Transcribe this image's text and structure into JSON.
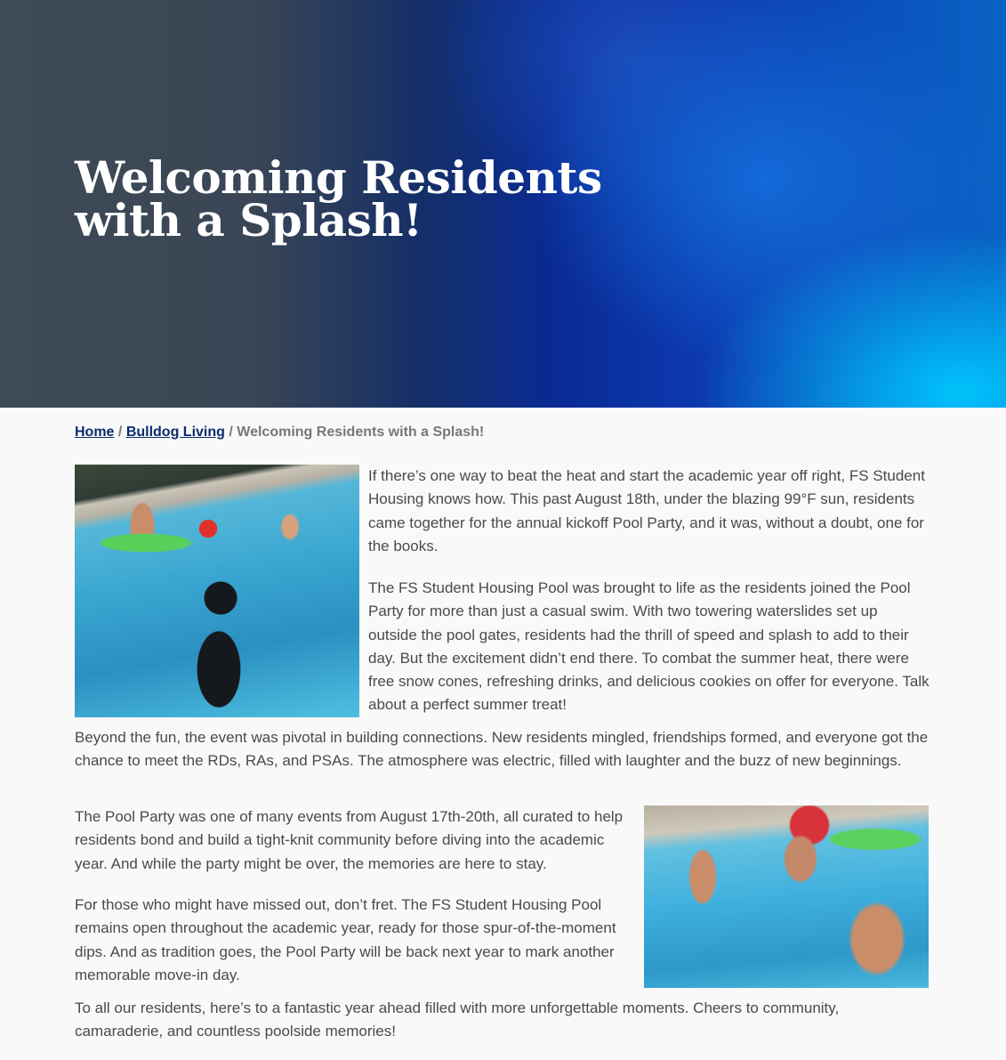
{
  "hero": {
    "title_line1": "Welcoming Residents",
    "title_line2": "with a Splash!"
  },
  "breadcrumb": {
    "home": "Home",
    "sep1": "/",
    "section": "Bulldog Living",
    "sep2": "/",
    "current": "Welcoming Residents with a Splash!"
  },
  "article": {
    "p1": "If there’s one way to beat the heat and start the academic year off right, FS Student Housing knows how. This past August 18th, under the blazing 99°F sun, residents came together for the annual kickoff Pool Party, and it was, without a doubt, one for the books.",
    "p2": "The FS Student Housing Pool was brought to life as the residents joined the Pool Party for more than just a casual swim. With two towering waterslides set up outside the pool gates, residents had the thrill of speed and splash to add to their day. But the excitement didn’t end there. To combat the summer heat, there were free snow cones, refreshing drinks, and delicious cookies on offer for everyone. Talk about a perfect summer treat!",
    "p3": "Beyond the fun, the event was pivotal in building connections. New residents mingled, friendships formed, and everyone got the chance to meet the RDs, RAs, and PSAs. The atmosphere was electric, filled with laughter and the buzz of new beginnings.",
    "p4": "The Pool Party was one of many events from August 17th-20th, all curated to help residents bond and build a tight-knit community before diving into the academic year. And while the party might be over, the memories are here to stay.",
    "p5": "For those who might have missed out, don’t fret. The FS Student Housing Pool remains open throughout the academic year, ready for those spur-of-the-moment dips. And as tradition goes, the Pool Party will be back next year to mark another memorable move-in day.",
    "p6": "To all our residents, here’s to a fantastic year ahead filled with more unforgettable moments. Cheers to community, camaraderie, and countless poolside memories!"
  },
  "colors": {
    "link": "#0c2c6e",
    "text": "#4a4a4a",
    "hero_accent": "#00c8ff"
  }
}
